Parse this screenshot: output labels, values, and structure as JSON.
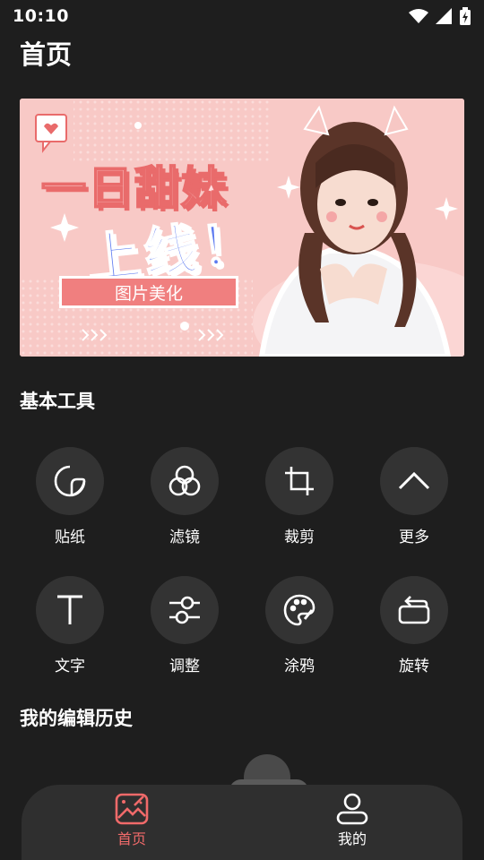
{
  "status_bar": {
    "time": "10:10"
  },
  "header": {
    "title": "首页"
  },
  "banner": {
    "headline": "一日甜妹",
    "subline": "上线！",
    "button_label": "图片美化"
  },
  "basic_tools": {
    "title": "基本工具",
    "items": [
      {
        "label": "贴纸",
        "icon": "sticker-icon"
      },
      {
        "label": "滤镜",
        "icon": "filter-icon"
      },
      {
        "label": "裁剪",
        "icon": "crop-icon"
      },
      {
        "label": "更多",
        "icon": "chevron-up-icon"
      },
      {
        "label": "文字",
        "icon": "text-icon"
      },
      {
        "label": "调整",
        "icon": "adjust-icon"
      },
      {
        "label": "涂鸦",
        "icon": "palette-icon"
      },
      {
        "label": "旋转",
        "icon": "rotate-icon"
      }
    ]
  },
  "history": {
    "title": "我的编辑历史"
  },
  "bottom_nav": {
    "active_color": "#f06a6a",
    "items": [
      {
        "label": "首页",
        "icon": "image-edit-icon",
        "active": true
      },
      {
        "label": "我的",
        "icon": "user-icon",
        "active": false
      }
    ]
  }
}
